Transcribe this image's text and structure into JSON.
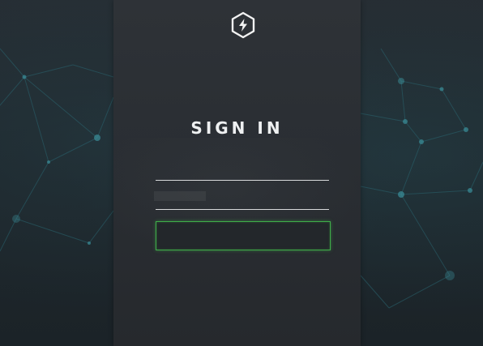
{
  "page": {
    "title": "SIGN IN"
  },
  "logo": {
    "icon": "lightning-bolt-hexagon-icon"
  },
  "form": {
    "username_value": "",
    "username_placeholder": "",
    "password_value": "",
    "password_placeholder": "",
    "submit_label": ""
  },
  "colors": {
    "accent": "#3fae49",
    "panel": "#2c3035",
    "background": "#1f272c",
    "network_lines": "#2a6470"
  }
}
